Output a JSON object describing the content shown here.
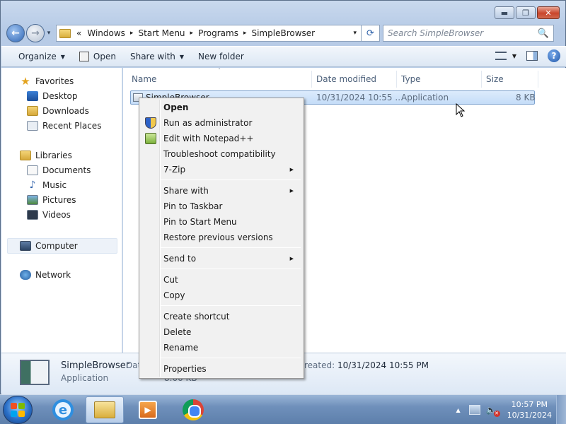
{
  "window": {
    "controls": {
      "minimize": "▬",
      "maximize": "❐",
      "close": "✕"
    }
  },
  "address": {
    "prefix": "«",
    "crumbs": [
      "Windows",
      "Start Menu",
      "Programs",
      "SimpleBrowser"
    ],
    "separator": "▸",
    "dropdown": "▾",
    "refresh": "⟳"
  },
  "search": {
    "placeholder": "Search SimpleBrowser",
    "icon": "🔍"
  },
  "toolbar": {
    "organize": "Organize",
    "open": "Open",
    "share_with": "Share with",
    "new_folder": "New folder",
    "arrow": "▼",
    "help": "?"
  },
  "navpane": {
    "favorites": "Favorites",
    "desktop": "Desktop",
    "downloads": "Downloads",
    "recent_places": "Recent Places",
    "libraries": "Libraries",
    "documents": "Documents",
    "music": "Music",
    "pictures": "Pictures",
    "videos": "Videos",
    "computer": "Computer",
    "network": "Network",
    "star": "★",
    "note": "♪"
  },
  "columns": {
    "name": "Name",
    "date_modified": "Date modified",
    "type": "Type",
    "size": "Size",
    "sort_caret": "ˆ"
  },
  "files": [
    {
      "name": "SimpleBrowser",
      "date_modified": "10/31/2024 10:55 ...",
      "type": "Application",
      "size": "8 KB"
    }
  ],
  "details": {
    "name": "SimpleBrowser",
    "type": "Application",
    "date_label_partial": "Dat",
    "created_label": "reated:",
    "created_value": "10/31/2024 10:55 PM",
    "size_partial": "8.00 KB"
  },
  "context_menu": {
    "open": "Open",
    "run_as_admin": "Run as administrator",
    "edit_npp": "Edit with Notepad++",
    "troubleshoot": "Troubleshoot compatibility",
    "seven_zip": "7-Zip",
    "share_with": "Share with",
    "pin_taskbar": "Pin to Taskbar",
    "pin_start": "Pin to Start Menu",
    "restore_versions": "Restore previous versions",
    "send_to": "Send to",
    "cut": "Cut",
    "copy": "Copy",
    "create_shortcut": "Create shortcut",
    "delete": "Delete",
    "rename": "Rename",
    "properties": "Properties",
    "submenu_arrow": "▶"
  },
  "taskbar": {
    "ie_letter": "e",
    "media_glyph": "▶",
    "tray_up": "▲",
    "volume_glyph": "🔈",
    "volume_mute": "✕",
    "clock_time": "10:57 PM",
    "clock_date": "10/31/2024"
  }
}
